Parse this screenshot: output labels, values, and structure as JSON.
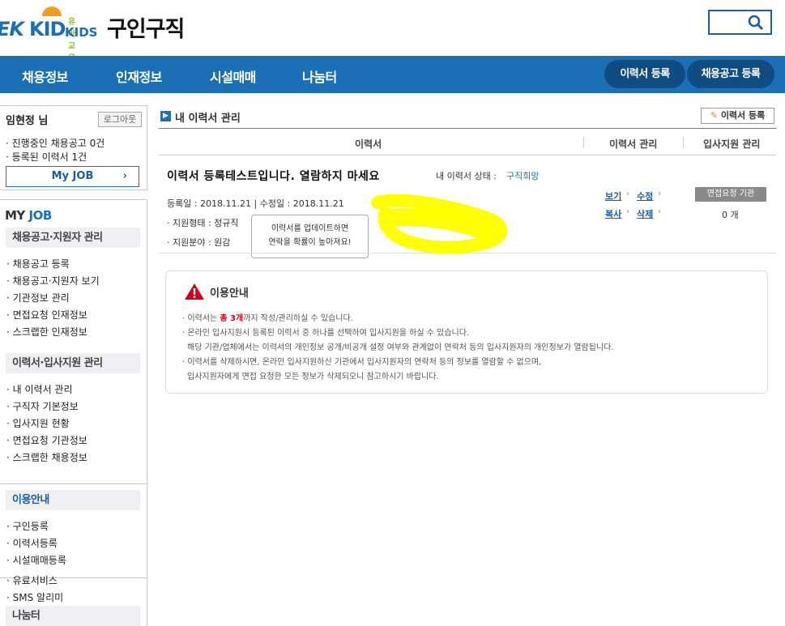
{
  "header": {
    "logo_ek": "EK",
    "logo_kid": "KID",
    "logo_small_top": "유아교육",
    "logo_small_bottom": "KIDS",
    "site_title": "구인구직"
  },
  "nav": {
    "items": [
      "채용정보",
      "인재정보",
      "시설매매",
      "나눔터"
    ],
    "resume_register": "이력서 등록",
    "job_post_register": "채용공고 등록"
  },
  "sidebar": {
    "user_name": "임현정 님",
    "logout": "로그아웃",
    "active_jobs": "진행중인 채용공고 0건",
    "registered_resumes": "등록된 이력서 1건",
    "myjob_button": "My JOB",
    "myjob_arrow": "›",
    "my_job_title_a": "MY",
    "my_job_title_b": "JOB",
    "section1": {
      "title": "채용공고·지원자 관리",
      "links": [
        "채용공고 등록",
        "채용공고·지원자 보기",
        "기관정보 관리",
        "면접요청 인재정보",
        "스크랩한 인재정보"
      ]
    },
    "section2": {
      "title": "이력서·입사지원 관리",
      "links": [
        "내 이력서 관리",
        "구직자 기본정보",
        "입사지원 현황",
        "면접요청 기관정보",
        "스크랩한 채용정보"
      ]
    },
    "section3": {
      "title": "이용안내",
      "links": [
        "구인등록",
        "이력서등록",
        "시설매매등록",
        "유료서비스",
        "SMS 알리미"
      ]
    },
    "section4": {
      "title": "나눔터"
    }
  },
  "main": {
    "title_icon": "▶",
    "page_title": "내 이력서 관리",
    "resume_register_btn": "이력서 등록",
    "columns": [
      "이력서",
      "이력서 관리",
      "입사지원 관리"
    ],
    "resume": {
      "title": "이력서 등록테스트입니다. 열람하지 마세요",
      "status_label": "내 이력서 상태 :",
      "status_value": "구직희망",
      "dates": "등록일 : 2018.11.21 | 수정일 : 2018.11.21",
      "type_line": "지원형태 : 정규직",
      "field_line": "지원분야 : 원감",
      "tooltip_line1": "이력서를 업데이트하면",
      "tooltip_line2": "연락을 확률이 높아져요!",
      "actions": [
        "보기",
        "수정",
        "복사",
        "삭제"
      ],
      "arrow": "›",
      "badge": "면접요청 기관",
      "count": "0 개"
    },
    "notice": {
      "title": "이용안내",
      "line1_prefix": "· 이력서는 ",
      "line1_hl": "총 3개",
      "line1_suffix": "까지 작성/관리하실 수 있습니다.",
      "line2": "· 온라인 입사지원시 등록된 이력서 중 하나를 선택하여 입사지원을 하실 수 있습니다.",
      "line3": "해당 기관/업체에서는 이력서의 개인정보 공개/비공개 설정 여부와 관계없이 연락처 등의 입사지원자의 개인정보가 열람됩니다.",
      "line4": "· 이력서를 삭제하시면, 온라인 입사지원하신 기관에서 입사지원자의 연락처 등의 정보를 열람할 수 없으며,",
      "line5": "입사지원자에게 면접 요청한 모든 정보가 삭제되오니 참고하시기 바랍니다."
    }
  },
  "colors": {
    "brand_blue": "#1a6fb5",
    "nav_button": "#0f4c82",
    "highlight_yellow": "#ffff00",
    "warning_red": "#d0021b"
  }
}
